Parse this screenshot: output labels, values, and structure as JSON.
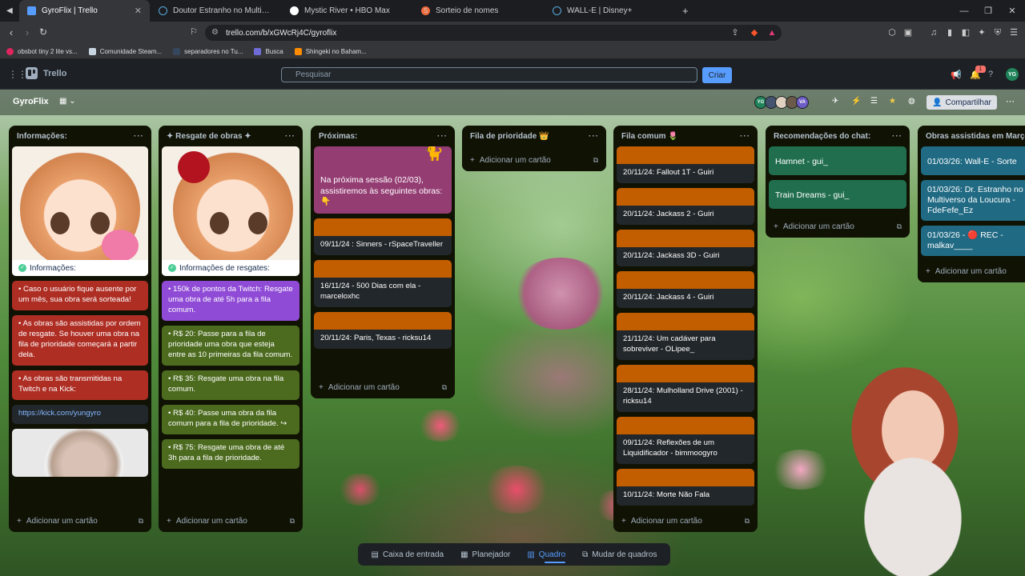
{
  "browser": {
    "tabs": [
      {
        "label": "GyroFlix | Trello",
        "active": true
      },
      {
        "label": "Doutor Estranho no Multiverso da Lo",
        "active": false
      },
      {
        "label": "Mystic River • HBO Max",
        "active": false
      },
      {
        "label": "Sorteio de nomes",
        "active": false
      },
      {
        "label": "WALL-E | Disney+",
        "active": false
      }
    ],
    "new_tab": "+",
    "url": "trello.com/b/xGWcRj4C/gyroflix",
    "bookmarks": [
      {
        "label": "obsbot tiny 2 lite vs...",
        "color": "#e0245e"
      },
      {
        "label": "Comunidade Steam...",
        "color": "#2a475e"
      },
      {
        "label": "separadores no Tu...",
        "color": "#36465d"
      },
      {
        "label": "Busca",
        "color": "#6f6cd8"
      },
      {
        "label": "Shingeki no Baham...",
        "color": "#ff8c00"
      }
    ]
  },
  "trello": {
    "logo": "Trello",
    "search_placeholder": "Pesquisar",
    "create_label": "Criar",
    "notification_count": "1",
    "me_initials": "YG"
  },
  "board": {
    "title": "GyroFlix",
    "share_label": "Compartilhar",
    "members": [
      "YG",
      "",
      "",
      "",
      "VA"
    ],
    "add_card": "Adicionar um cartão",
    "lists": [
      {
        "title": "Informações:",
        "image_caption": "Informações:",
        "cards": [
          "• Caso o usuário fique ausente por um mês, sua obra será sorteada!",
          "• As obras são assistidas por ordem de resgate. Se houver uma obra na fila de prioridade começará a partir dela.",
          "• As obras são transmitidas na Twitch e na Kick:"
        ],
        "link": "https://kick.com/yungyro"
      },
      {
        "title": "✦ Resgate de obras ✦",
        "image_caption": "Informações de resgates:",
        "cards": [
          "• 150k de pontos da Twitch: Resgate uma obra de até 5h para a fila comum.",
          "• R$ 20: Passe para a fila de prioridade uma obra que esteja entre as 10 primeiras da fila comum.",
          "• R$ 35: Resgate uma obra na fila comum.",
          "• R$ 40: Passe uma obra da fila comum para a fila de prioridade. ↪",
          "• R$ 75: Resgate uma obra de até 3h para a fila de prioridade."
        ]
      },
      {
        "title": "Próximas:",
        "intro": "Na próxima sessão (02/03), assistiremos às seguintes obras: 👇",
        "cards": [
          "09/11/24 : Sinners - rSpaceTraveller",
          "16/11/24 - 500 Dias com ela - marceloxhc",
          "20/11/24: Paris, Texas - ricksu14"
        ]
      },
      {
        "title": "Fila de prioridade 👑",
        "cards": []
      },
      {
        "title": "Fila comum 🌷",
        "cards": [
          "20/11/24: Fallout 1T - Guiri",
          "20/11/24: Jackass 2 - Guiri",
          "20/11/24: Jackass 3D - Guiri",
          "20/11/24: Jackass 4 - Guiri",
          "21/11/24: Um cadáver para sobreviver - OLipee_",
          "28/11/24: Mulholland Drive (2001) - ricksu14",
          "09/11/24: Reflexões de um Liquidificador - bimmoogyro",
          "10/11/24: Morte Não Fala"
        ]
      },
      {
        "title": "Recomendações do chat:",
        "cards": [
          "Hamnet - gui_",
          "Train Dreams - gui_"
        ]
      },
      {
        "title": "Obras assistidas em Março",
        "cards": [
          "01/03/26: Wall-E - Sorte",
          "01/03/26: Dr. Estranho no Multiverso da Loucura - FdeFefe_Ez",
          "01/03/26 - 🔴 REC - malkav____"
        ]
      }
    ]
  },
  "bottom_nav": [
    {
      "label": "Caixa de entrada",
      "icon": "inbox-icon"
    },
    {
      "label": "Planejador",
      "icon": "calendar-icon"
    },
    {
      "label": "Quadro",
      "icon": "board-icon",
      "active": true
    },
    {
      "label": "Mudar de quadros",
      "icon": "switch-boards-icon"
    }
  ]
}
